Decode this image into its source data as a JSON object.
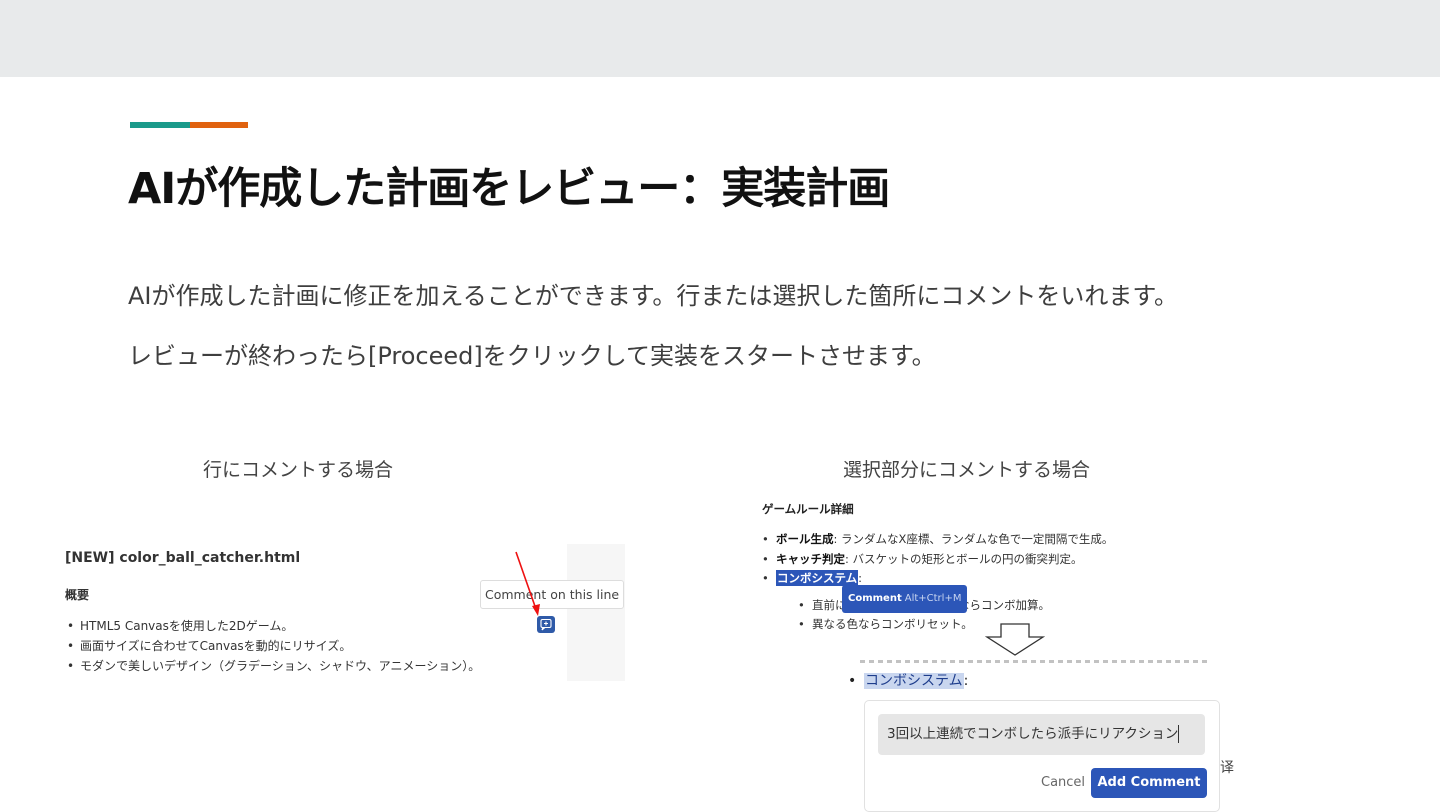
{
  "slide": {
    "title": "AIが作成した計画をレビュー：実装計画",
    "paragraph1": "AIが作成した計画に修正を加えることができます。行または選択した箇所にコメントをいれます。",
    "paragraph2": "レビューが終わったら[Proceed]をクリックして実装をスタートさせます。",
    "colors": {
      "accent_teal": "#1a9a8a",
      "accent_orange": "#e0620f",
      "band": "#e8eaeb"
    }
  },
  "left_example": {
    "caption": "行にコメントする場合",
    "file_title": "[NEW] color_ball_catcher.html",
    "section": "概要",
    "items": [
      "HTML5 Canvasを使用した2Dゲーム。",
      "画面サイズに合わせてCanvasを動的にリサイズ。",
      "モダンで美しいデザイン（グラデーション、シャドウ、アニメーション）。"
    ],
    "tooltip": "Comment on this line",
    "button_icon": "comment-plus-icon",
    "accent": "#2f5aa8"
  },
  "right_example": {
    "caption": "選択部分にコメントする場合",
    "section": "ゲームルール詳細",
    "item1_bold": "ボール生成",
    "item1_text": ": ランダムなX座標、ランダムな色で一定間隔で生成。",
    "item2_bold": "キャッチ判定",
    "item2_text": ": バスケットの矩形とボールの円の衝突判定。",
    "item3_selected": "コンボシステム",
    "item3_suffix": ":",
    "sub1_prefix": "直前に",
    "sub1_suffix": "色ならコンボ加算。",
    "sub2": "異なる色ならコンボリセット。",
    "popup_label": "Comment",
    "popup_shortcut": "Alt+Ctrl+M",
    "highlight_label": "コンボシステム",
    "highlight_suffix": ":",
    "comment_text": "3回以上連続でコンボしたら派手にリアクション",
    "cancel_label": "Cancel",
    "add_label": "Add Comment",
    "stray_char": "译",
    "accent": "#2c56b8"
  }
}
